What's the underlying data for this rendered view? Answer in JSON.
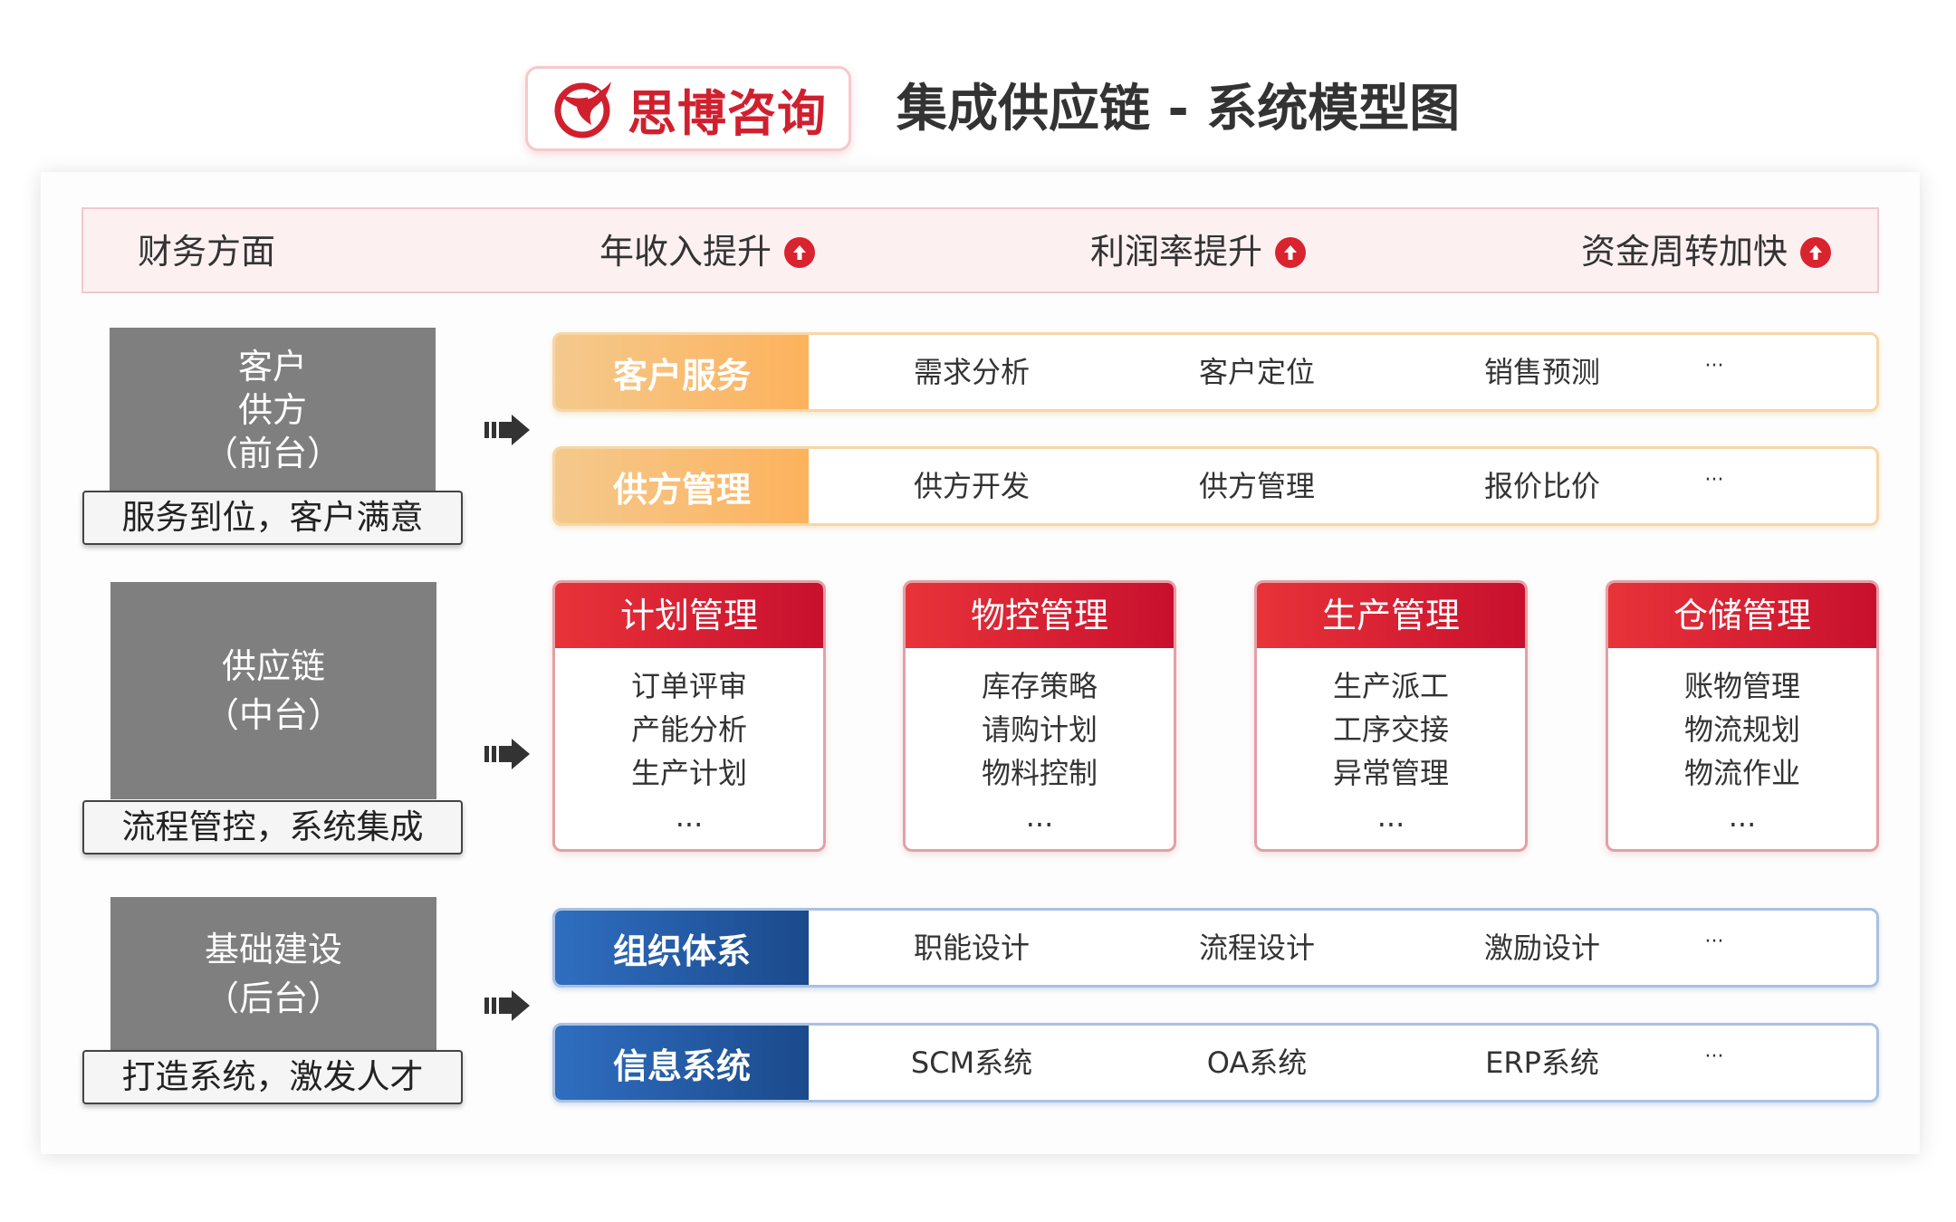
{
  "header": {
    "brand": "思博咨询",
    "title": "集成供应链 - 系统模型图"
  },
  "finance": {
    "label": "财务方面",
    "items": [
      "年收入提升",
      "利润率提升",
      "资金周转加快"
    ]
  },
  "layers": [
    {
      "lines": [
        "客户",
        "供方",
        "（前台）"
      ],
      "caption": "服务到位，客户满意"
    },
    {
      "lines": [
        "供应链",
        "（中台）"
      ],
      "caption": "流程管控，系统集成"
    },
    {
      "lines": [
        "基础建设",
        "（后台）"
      ],
      "caption": "打造系统，激发人才"
    }
  ],
  "front_rows": [
    {
      "tag": "客户服务",
      "cells": [
        "需求分析",
        "客户定位",
        "销售预测",
        "···"
      ]
    },
    {
      "tag": "供方管理",
      "cells": [
        "供方开发",
        "供方管理",
        "报价比价",
        "···"
      ]
    }
  ],
  "middle_cards": [
    {
      "title": "计划管理",
      "items": [
        "订单评审",
        "产能分析",
        "生产计划",
        "..."
      ]
    },
    {
      "title": "物控管理",
      "items": [
        "库存策略",
        "请购计划",
        "物料控制",
        "..."
      ]
    },
    {
      "title": "生产管理",
      "items": [
        "生产派工",
        "工序交接",
        "异常管理",
        "..."
      ]
    },
    {
      "title": "仓储管理",
      "items": [
        "账物管理",
        "物流规划",
        "物流作业",
        "..."
      ]
    }
  ],
  "back_rows": [
    {
      "tag": "组织体系",
      "cells": [
        "职能设计",
        "流程设计",
        "激励设计",
        "···"
      ]
    },
    {
      "tag": "信息系统",
      "cells": [
        "SCM系统",
        "OA系统",
        "ERP系统",
        "···"
      ]
    }
  ],
  "colors": {
    "brand_red": "#d0202e",
    "layer_gray": "#7f7f7f",
    "orange_tag": "#fdb25c",
    "blue_tag": "#1b4a8c",
    "card_red": "#e83339"
  }
}
